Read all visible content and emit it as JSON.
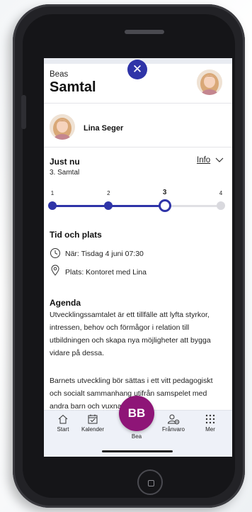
{
  "header": {
    "parent_name": "Beas",
    "title": "Samtal",
    "close_symbol": "✕"
  },
  "child": {
    "name": "Lina Seger"
  },
  "progress": {
    "heading": "Just nu",
    "info_label": "Info",
    "current_step_label": "3. Samtal",
    "steps": [
      "1",
      "2",
      "3",
      "4"
    ],
    "current_step": 3,
    "accent_color": "#2f34a8",
    "inactive_color": "#d9d9de"
  },
  "details": {
    "heading": "Tid och plats",
    "when": "När: Tisdag 4 juni 07:30",
    "where": "Plats: Kontoret med Lina"
  },
  "agenda": {
    "heading": "Agenda",
    "paragraph1": "Utvecklingssamtalet är ett tillfälle att lyfta styrkor, intressen, behov och förmågor i relation till utbildningen och skapa nya möjligheter att bygga vidare på dessa.",
    "paragraph2": "Barnets utveckling bör sättas i ett vitt pedagogiskt och socialt sammanhang utifrån samspelet med andra barn och vuxna där"
  },
  "nav": {
    "start": "Start",
    "calendar": "Kalender",
    "profile_initials": "BB",
    "profile": "Bea",
    "absence": "Frånvaro",
    "more": "Mer",
    "profile_color": "#8e1577"
  },
  "icons": [
    "close-icon",
    "chevron-down-icon",
    "clock-icon",
    "location-pin-icon",
    "home-icon",
    "calendar-icon",
    "absence-icon",
    "more-grid-icon"
  ]
}
